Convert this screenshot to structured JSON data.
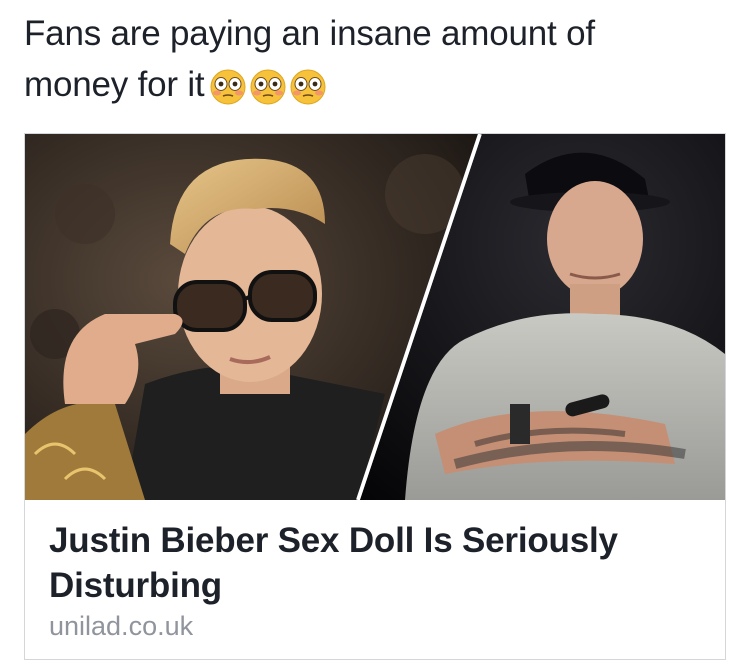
{
  "post": {
    "text_line1": "Fans are paying an insane amount of",
    "text_line2": "money for it",
    "emojis": [
      "flushed-face",
      "flushed-face",
      "flushed-face"
    ]
  },
  "link_card": {
    "title": "Justin Bieber Sex Doll Is Seriously Disturbing",
    "domain": "unilad.co.uk"
  },
  "colors": {
    "text": "#1d2129",
    "domain": "#90949c",
    "border": "#d3d6db",
    "emoji_face": "#f7c23b"
  }
}
